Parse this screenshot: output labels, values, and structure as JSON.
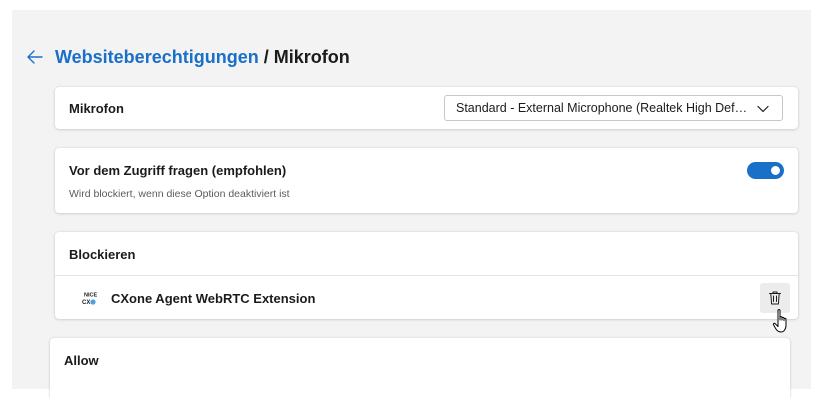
{
  "header": {
    "back_icon": "back-arrow-icon",
    "breadcrumb_link": "Websiteberechtigungen",
    "separator": " / ",
    "current": "Mikrofon"
  },
  "microphone": {
    "label": "Mikrofon",
    "selected_device": "Standard - External Microphone (Realtek High Definition Audio)",
    "chevron_icon": "chevron-down-icon"
  },
  "ask_before_access": {
    "label": "Vor dem Zugriff fragen (empfohlen)",
    "description": "Wird blockiert, wenn diese Option deaktiviert ist",
    "enabled": true
  },
  "block": {
    "header": "Blockieren",
    "sites": [
      {
        "name": "CXone Agent WebRTC Extension",
        "icon": "nice-cxone-icon",
        "delete_icon": "trash-icon"
      }
    ]
  },
  "allow": {
    "header": "Allow"
  },
  "colors": {
    "accent": "#1a6fc9",
    "page_background": "#f3f3f3",
    "card_background": "#ffffff",
    "secondary_text": "#5c5c5c"
  }
}
